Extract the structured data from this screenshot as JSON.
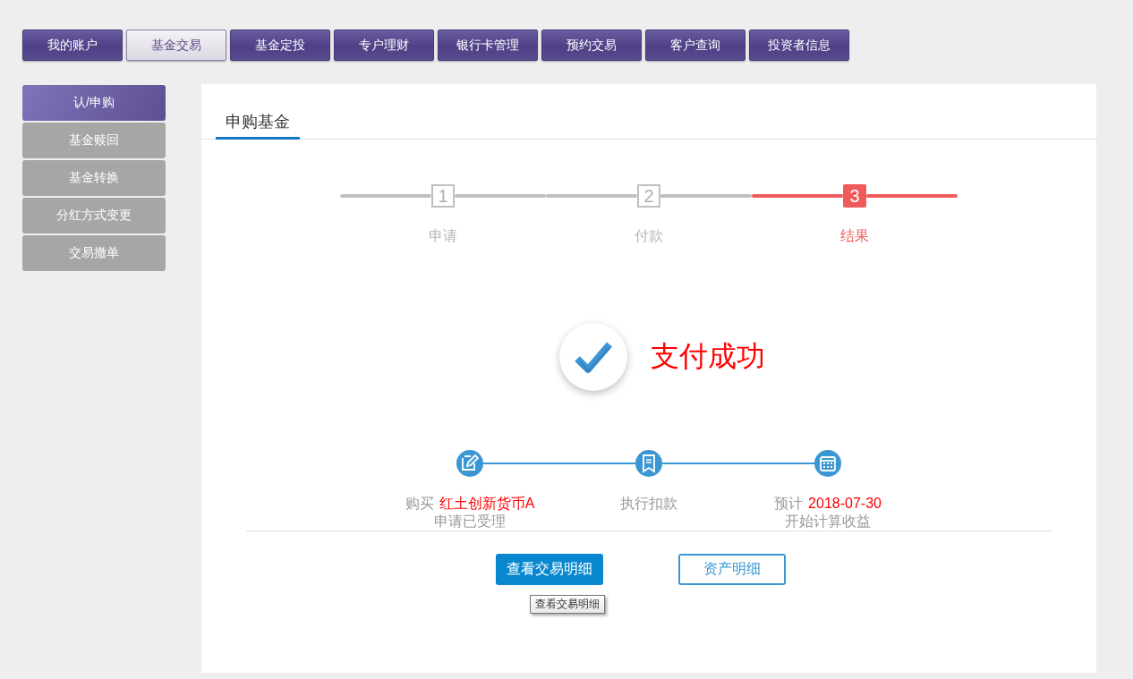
{
  "top_nav": [
    {
      "label": "我的账户",
      "selected": false
    },
    {
      "label": "基金交易",
      "selected": true
    },
    {
      "label": "基金定投",
      "selected": false
    },
    {
      "label": "专户理财",
      "selected": false
    },
    {
      "label": "银行卡管理",
      "selected": false
    },
    {
      "label": "预约交易",
      "selected": false
    },
    {
      "label": "客户查询",
      "selected": false
    },
    {
      "label": "投资者信息",
      "selected": false
    }
  ],
  "sidebar": {
    "items": [
      {
        "label": "认/申购",
        "selected": true
      },
      {
        "label": "基金赎回",
        "selected": false
      },
      {
        "label": "基金转换",
        "selected": false
      },
      {
        "label": "分红方式变更",
        "selected": false
      },
      {
        "label": "交易撤单",
        "selected": false
      }
    ]
  },
  "panel": {
    "tab": "申购基金",
    "steps": [
      {
        "number": "1",
        "label": "申请",
        "selected": false
      },
      {
        "number": "2",
        "label": "付款",
        "selected": false
      },
      {
        "number": "3",
        "label": "结果",
        "selected": true
      }
    ],
    "result": {
      "message": "支付成功"
    },
    "timeline": [
      {
        "kind": "edit",
        "label": "购买",
        "value": "红土创新货币A",
        "note": "申请已受理"
      },
      {
        "kind": "bookmark",
        "label": "执行扣款"
      },
      {
        "kind": "calendar",
        "label": "预计",
        "value": "2018-07-30",
        "note": "开始计算收益"
      }
    ],
    "buttons": [
      {
        "label": "查看交易明细",
        "kind": "primary"
      },
      {
        "label": "资产明细",
        "kind": "outline"
      }
    ],
    "tooltip": "查看交易明细"
  }
}
